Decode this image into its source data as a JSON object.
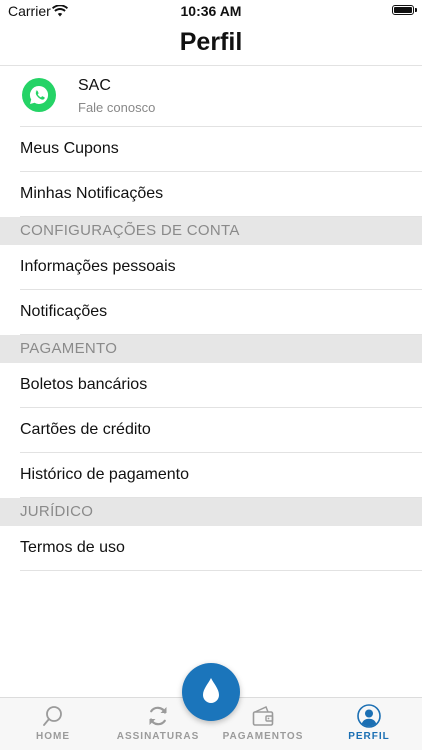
{
  "status_bar": {
    "carrier": "Carrier",
    "time": "10:36 AM"
  },
  "header": {
    "title": "Perfil"
  },
  "sac": {
    "title": "SAC",
    "subtitle": "Fale conosco",
    "icon": "whatsapp-icon"
  },
  "rows_top": [
    "Meus Cupons",
    "Minhas Notificações"
  ],
  "section_account": {
    "label": "CONFIGURAÇÕES DE CONTA",
    "items": [
      "Informações pessoais",
      "Notificações"
    ]
  },
  "section_payment": {
    "label": "PAGAMENTO",
    "items": [
      "Boletos bancários",
      "Cartões de crédito",
      "Histórico de pagamento"
    ]
  },
  "section_legal": {
    "label": "JURÍDICO",
    "items": [
      "Termos de uso"
    ]
  },
  "tabbar": {
    "tabs": [
      {
        "label": "HOME",
        "icon": "search-icon"
      },
      {
        "label": "ASSINATURAS",
        "icon": "refresh-icon"
      },
      {
        "label": "PAGAMENTOS",
        "icon": "wallet-icon"
      },
      {
        "label": "PERFIL",
        "icon": "user-icon",
        "active": true
      }
    ],
    "center_button_icon": "water-drop-icon"
  },
  "colors": {
    "accent": "#1b75bb",
    "active_tab": "#1b6fb3",
    "whatsapp": "#25d366",
    "section_bg": "#e6e6e6"
  }
}
